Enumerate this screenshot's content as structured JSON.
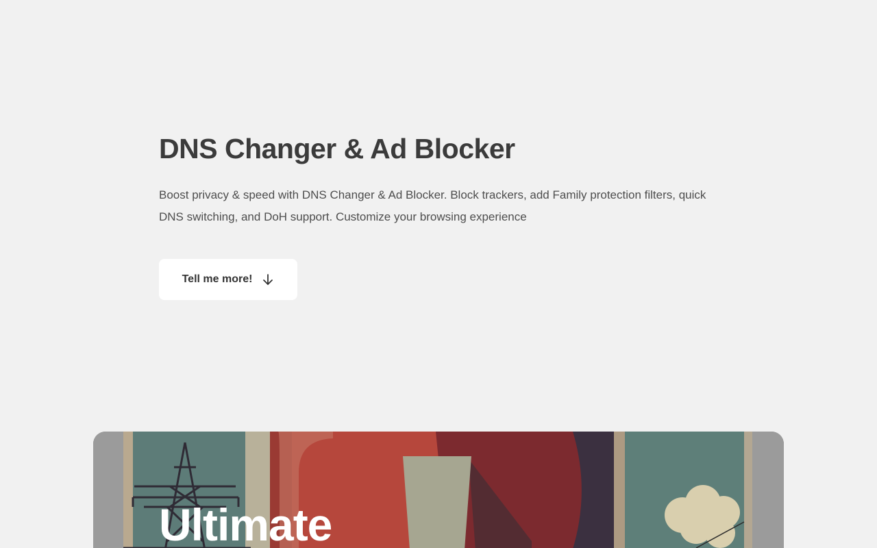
{
  "hero": {
    "title": "DNS Changer & Ad Blocker",
    "description": "Boost privacy & speed with DNS Changer & Ad Blocker. Block trackers, add Family protection filters, quick DNS switching, and DoH support. Customize your browsing experience",
    "cta_label": "Tell me more!",
    "cta_icon": "arrow-down-icon"
  },
  "banner": {
    "title": "Ultimate",
    "illustration": "retro-poster-illustration"
  },
  "colors": {
    "background": "#f1f1f1",
    "text": "#3b3b3b",
    "button_bg": "#ffffff",
    "banner_frame": "#9b9b9b"
  }
}
